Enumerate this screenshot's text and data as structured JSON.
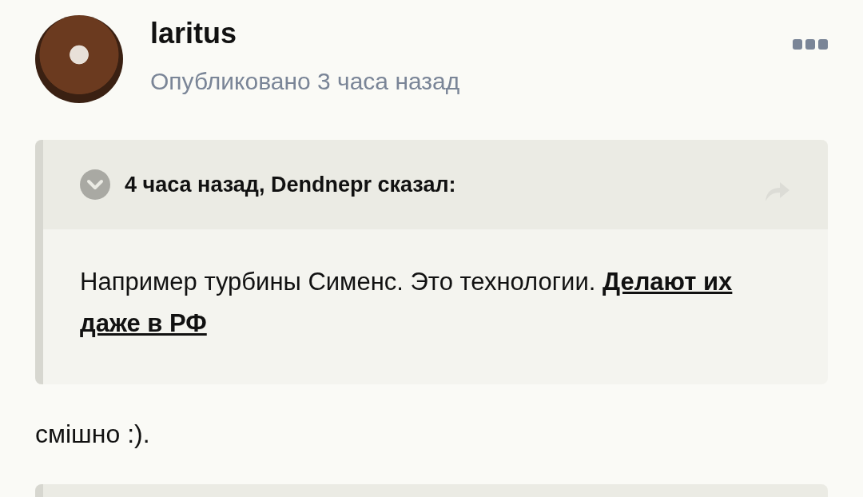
{
  "post": {
    "author": "laritus",
    "published": "Опубликовано 3 часа назад"
  },
  "quote": {
    "header": "4 часа назад, Dendnepr сказал:",
    "text": "Например турбины Сименс. Это технологии. **Делают их даже в РФ**"
  },
  "reply": "смішно :)."
}
